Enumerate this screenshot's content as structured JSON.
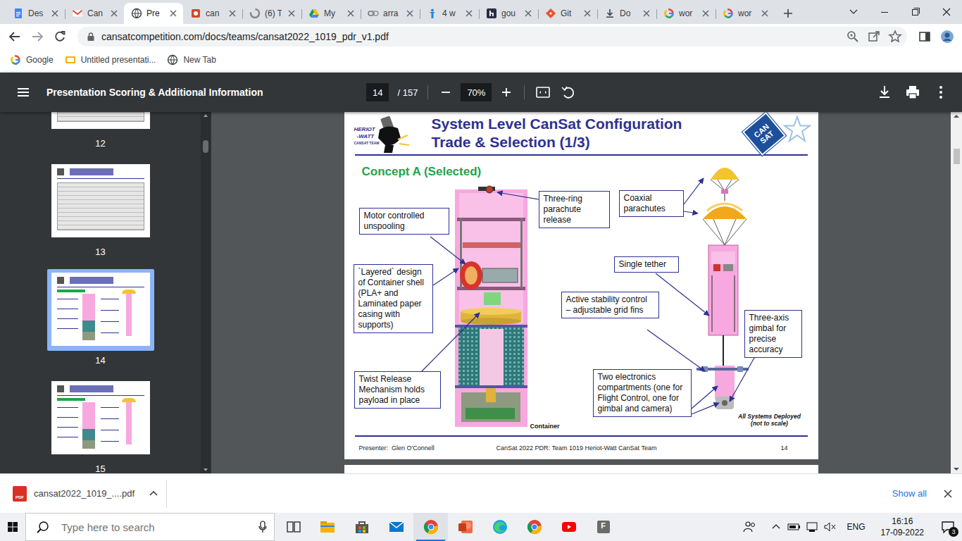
{
  "browser": {
    "tabs": [
      {
        "label": "Des",
        "selected": false,
        "kind": "docs"
      },
      {
        "label": "Can",
        "selected": false,
        "kind": "gmail"
      },
      {
        "label": "Pre",
        "selected": true,
        "kind": "globe"
      },
      {
        "label": "can",
        "selected": false,
        "kind": "slides"
      },
      {
        "label": "(6) T",
        "selected": false,
        "kind": "swirl"
      },
      {
        "label": "My",
        "selected": false,
        "kind": "drive"
      },
      {
        "label": "arra",
        "selected": false,
        "kind": "link"
      },
      {
        "label": "4 w",
        "selected": false,
        "kind": "person"
      },
      {
        "label": "gou",
        "selected": false,
        "kind": "hsquare"
      },
      {
        "label": "Git",
        "selected": false,
        "kind": "git"
      },
      {
        "label": "Do",
        "selected": false,
        "kind": "download"
      },
      {
        "label": "wor",
        "selected": false,
        "kind": "google"
      },
      {
        "label": "wor",
        "selected": false,
        "kind": "google"
      }
    ],
    "url": "cansatcompetition.com/docs/teams/cansat2022_1019_pdr_v1.pdf",
    "bookmarks": [
      {
        "label": "Google",
        "kind": "google"
      },
      {
        "label": "Untitled presentati...",
        "kind": "folder"
      },
      {
        "label": "New Tab",
        "kind": "globe"
      }
    ]
  },
  "pdf_viewer": {
    "title": "Presentation Scoring & Additional Information",
    "page": "14",
    "page_total": "/ 157",
    "zoom": "70%",
    "thumbnails": [
      {
        "label": "12",
        "selected": false,
        "kind": "table"
      },
      {
        "label": "13",
        "selected": false,
        "kind": "table"
      },
      {
        "label": "14",
        "selected": true,
        "kind": "diagram"
      },
      {
        "label": "15",
        "selected": false,
        "kind": "diagram"
      }
    ],
    "slide": {
      "team_logo": [
        "HERIOT",
        "-WATT",
        "CANSAT TEAM"
      ],
      "title_lines": [
        "System Level CanSat Configuration",
        "Trade & Selection (1/3)"
      ],
      "badge": [
        "CAN",
        "SAT"
      ],
      "concept": "Concept A (Selected)",
      "callouts": [
        "Motor controlled unspooling",
        "`Layered` design of Container shell (PLA+ and Laminated paper casing with supports)",
        "Twist Release Mechanism holds payload in place",
        "Three-ring parachute release",
        "Coaxial parachutes",
        "Single tether",
        "Active stability control – adjustable grid fins",
        "Three-axis gimbal for precise accuracy",
        "Two electronics compartments (one for Flight Control, one for gimbal and camera)"
      ],
      "container_caption": "Container",
      "deployed_caption": [
        "All Systems Deployed",
        "(not to scale)"
      ],
      "footer": {
        "presenter": "Presenter:  Glen O'Connell",
        "event": "CanSat 2022 PDR: Team 1019 Heriot-Watt CanSat Team",
        "page": "14"
      }
    }
  },
  "download_shelf": {
    "file_badge": "PDF",
    "filename": "cansat2022_1019_....pdf",
    "show_all": "Show all"
  },
  "taskbar": {
    "search": {
      "placeholder": "Type here to search"
    },
    "apps": [
      {
        "kind": "explorer",
        "selected": false
      },
      {
        "kind": "store",
        "selected": false
      },
      {
        "kind": "mail",
        "selected": false
      },
      {
        "kind": "chrome",
        "selected": true
      },
      {
        "kind": "powerpoint",
        "selected": false
      },
      {
        "kind": "edge",
        "selected": false
      },
      {
        "kind": "chrome",
        "selected": false
      },
      {
        "kind": "youtube",
        "selected": false
      },
      {
        "kind": "letter",
        "selected": false,
        "letter": "F"
      }
    ],
    "language": "ENG",
    "time": "16:16",
    "date": "17-09-2022",
    "notifications": "3"
  }
}
